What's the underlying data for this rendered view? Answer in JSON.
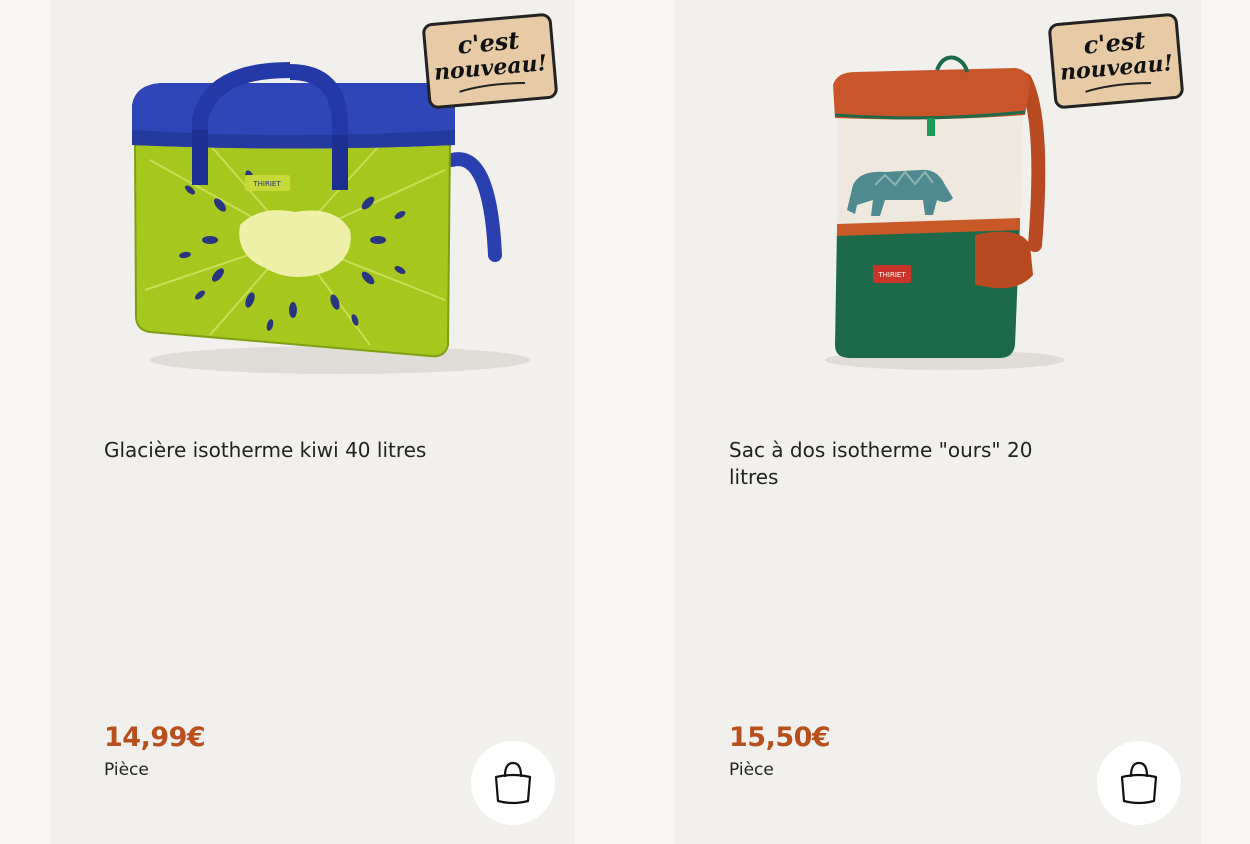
{
  "products": [
    {
      "image_alt": "Glacière isotherme kiwi",
      "badge": {
        "line1": "c'est",
        "line2": "nouveau!"
      },
      "title": "Glacière isotherme kiwi 40 litres",
      "price": "14,99€",
      "unit": "Pièce",
      "add_to_cart_icon": "shopping-bag-icon"
    },
    {
      "image_alt": "Sac à dos isotherme ours",
      "badge": {
        "line1": "c'est",
        "line2": "nouveau!"
      },
      "title": "Sac à dos isotherme \"ours\" 20 litres",
      "price": "15,50€",
      "unit": "Pièce",
      "add_to_cart_icon": "shopping-bag-icon"
    }
  ],
  "colors": {
    "price": "#b8501e",
    "badge": "#e6cba6",
    "card": "#f2f0ed"
  }
}
